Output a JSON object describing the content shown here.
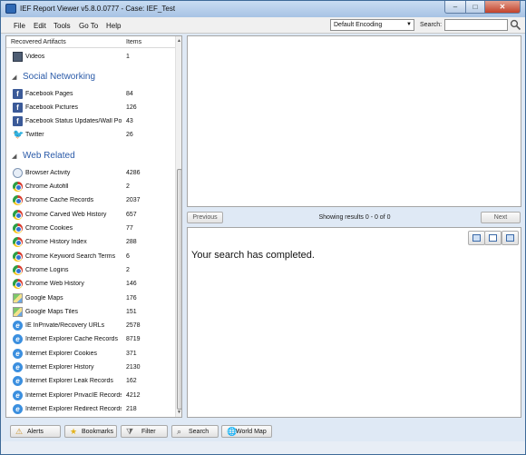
{
  "window": {
    "title": "IEF Report Viewer v5.8.0.0777 - Case: IEF_Test",
    "controls": {
      "minimize": "–",
      "maximize": "□",
      "close": "✕"
    }
  },
  "menu": [
    "File",
    "Edit",
    "Tools",
    "Go To",
    "Help"
  ],
  "toolbar": {
    "encoding_value": "Default Encoding",
    "search_label": "Search:",
    "search_value": ""
  },
  "artifacts": {
    "header": {
      "name": "Recovered Artifacts",
      "items": "Items"
    },
    "top_rows": [
      {
        "label": "Videos",
        "count": "1",
        "icon": "video-icon"
      }
    ],
    "groups": [
      {
        "title": "Social Networking",
        "rows": [
          {
            "label": "Facebook Pages",
            "count": "84",
            "icon": "facebook-icon"
          },
          {
            "label": "Facebook Pictures",
            "count": "126",
            "icon": "facebook-icon"
          },
          {
            "label": "Facebook Status Updates/Wall Po...",
            "count": "43",
            "icon": "facebook-icon"
          },
          {
            "label": "Twitter",
            "count": "26",
            "icon": "twitter-icon"
          }
        ]
      },
      {
        "title": "Web Related",
        "rows": [
          {
            "label": "Browser Activity",
            "count": "4286",
            "icon": "browser-icon"
          },
          {
            "label": "Chrome Autofill",
            "count": "2",
            "icon": "chrome-icon"
          },
          {
            "label": "Chrome Cache Records",
            "count": "2037",
            "icon": "chrome-icon"
          },
          {
            "label": "Chrome Carved Web History",
            "count": "657",
            "icon": "chrome-icon"
          },
          {
            "label": "Chrome Cookies",
            "count": "77",
            "icon": "chrome-icon"
          },
          {
            "label": "Chrome History Index",
            "count": "288",
            "icon": "chrome-icon"
          },
          {
            "label": "Chrome Keyword Search Terms",
            "count": "6",
            "icon": "chrome-icon"
          },
          {
            "label": "Chrome Logins",
            "count": "2",
            "icon": "chrome-icon"
          },
          {
            "label": "Chrome Web History",
            "count": "146",
            "icon": "chrome-icon"
          },
          {
            "label": "Google Maps",
            "count": "176",
            "icon": "google-maps-icon"
          },
          {
            "label": "Google Maps Tiles",
            "count": "151",
            "icon": "google-maps-icon"
          },
          {
            "label": "IE InPrivate/Recovery URLs",
            "count": "2578",
            "icon": "internet-explorer-icon"
          },
          {
            "label": "Internet Explorer Cache Records",
            "count": "8719",
            "icon": "internet-explorer-icon"
          },
          {
            "label": "Internet Explorer Cookies",
            "count": "371",
            "icon": "internet-explorer-icon"
          },
          {
            "label": "Internet Explorer History",
            "count": "2130",
            "icon": "internet-explorer-icon"
          },
          {
            "label": "Internet Explorer Leak Records",
            "count": "162",
            "icon": "internet-explorer-icon"
          },
          {
            "label": "Internet Explorer PrivacIE Records",
            "count": "4212",
            "icon": "internet-explorer-icon"
          },
          {
            "label": "Internet Explorer Redirect Records",
            "count": "218",
            "icon": "internet-explorer-icon"
          }
        ]
      }
    ]
  },
  "results": {
    "previous_label": "Previous",
    "next_label": "Next",
    "status": "Showing results 0 - 0 of 0",
    "message": "Your search has completed."
  },
  "bottom_buttons": [
    {
      "label": "Alerts",
      "icon": "alert-icon"
    },
    {
      "label": "Bookmarks",
      "icon": "star-icon"
    },
    {
      "label": "Filter",
      "icon": "filter-icon"
    },
    {
      "label": "Search",
      "icon": "magnifier-icon"
    },
    {
      "label": "World Map",
      "icon": "globe-icon"
    }
  ],
  "colors": {
    "group_title": "#2a5aa8",
    "frame": "#dfe9f5",
    "facebook": "#3b5a98",
    "twitter": "#2aa3df"
  }
}
